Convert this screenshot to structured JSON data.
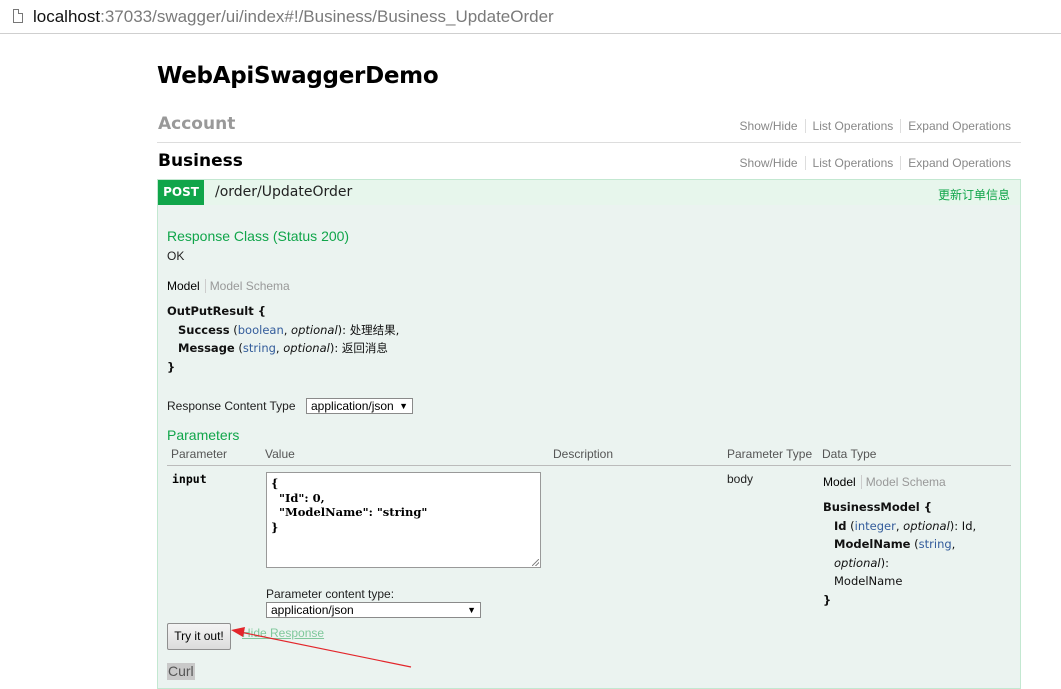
{
  "browser": {
    "url_host": "localhost",
    "url_rest": ":37033/swagger/ui/index#!/Business/Business_UpdateOrder"
  },
  "app": {
    "title": "WebApiSwaggerDemo"
  },
  "resources": [
    {
      "name": "Account",
      "ops": [
        "Show/Hide",
        "List Operations",
        "Expand Operations"
      ]
    },
    {
      "name": "Business",
      "ops": [
        "Show/Hide",
        "List Operations",
        "Expand Operations"
      ]
    }
  ],
  "operation": {
    "method": "POST",
    "path": "/order/UpdateOrder",
    "summary": "更新订单信息",
    "response_class_title": "Response Class (Status 200)",
    "response_class_value": "OK",
    "model_tab": "Model",
    "schema_tab": "Model Schema",
    "response_model": {
      "name": "OutPutResult {",
      "close": "}",
      "props": [
        {
          "name": "Success",
          "open": " (",
          "type": "boolean",
          "sep": ", ",
          "opt": "optional",
          "close": "): ",
          "desc": "处理结果,"
        },
        {
          "name": "Message",
          "open": " (",
          "type": "string",
          "sep": ", ",
          "opt": "optional",
          "close": "): ",
          "desc": "返回消息"
        }
      ]
    },
    "response_content_type_label": "Response Content Type",
    "response_content_type_value": "application/json",
    "parameters_title": "Parameters",
    "param_headers": [
      "Parameter",
      "Value",
      "Description",
      "Parameter Type",
      "Data Type"
    ],
    "param": {
      "name": "input",
      "value": "{\n  \"Id\": 0,\n  \"ModelName\": \"string\"\n}",
      "param_type": "body",
      "content_type_label": "Parameter content type:",
      "content_type_value": "application/json",
      "model": {
        "name": "BusinessModel {",
        "close": "}",
        "id_name": "Id",
        "id_type": "integer",
        "id_opt": "optional",
        "id_desc": "Id,",
        "mn_name": "ModelName",
        "mn_type": "string",
        "mn_opt": "optional",
        "mn_desc": "ModelName"
      }
    },
    "try_button": "Try it out!",
    "hide_response": "Hide Response",
    "curl_label": "Curl"
  },
  "colors": {
    "post_green": "#10a54a",
    "panel_bg": "#ebf3f0",
    "arrow_red": "#e3262b"
  }
}
